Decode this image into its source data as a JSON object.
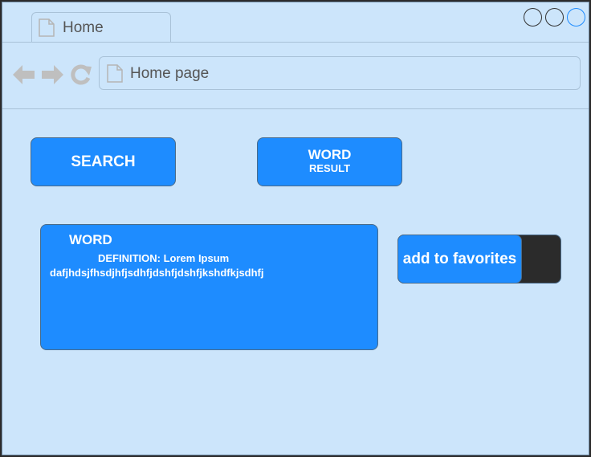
{
  "browser": {
    "tab_label": "Home",
    "url": "Home page"
  },
  "buttons": {
    "search": "SEARCH",
    "word_result_line1": "WORD",
    "word_result_line2": "RESULT"
  },
  "word_card": {
    "word": "WORD",
    "definition_label": "DEFINITION: Lorem Ipsum",
    "definition_text": "dafjhdsjfhsdjhfjsdhfjdshfjdshfjkshdfkjsdhfj"
  },
  "favorites": {
    "label": "add to favorites"
  },
  "icons": {
    "tab": "page-icon",
    "back": "back-arrow-icon",
    "forward": "forward-arrow-icon",
    "reload": "reload-icon",
    "url": "page-icon"
  },
  "colors": {
    "background": "#cce5fb",
    "accent": "#1e8cff",
    "toggle_dark": "#2b2b2b"
  }
}
